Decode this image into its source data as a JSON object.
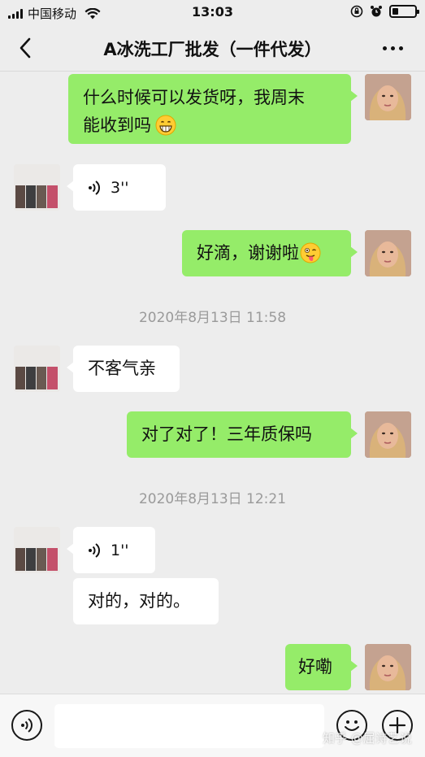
{
  "status_bar": {
    "carrier": "中国移动",
    "time": "13:03"
  },
  "header": {
    "title": "A冰洗工厂批发（一件代发）"
  },
  "messages": [
    {
      "side": "right",
      "type": "text",
      "text": "什么时候可以发货呀，我周末",
      "text2": "能收到吗"
    },
    {
      "side": "left",
      "type": "voice",
      "duration": "3''"
    },
    {
      "side": "right",
      "type": "text",
      "text": "好滴，谢谢啦"
    },
    {
      "type": "timestamp",
      "text": "2020年8月13日 11:58"
    },
    {
      "side": "left",
      "type": "text",
      "text": "不客气亲"
    },
    {
      "side": "right",
      "type": "text",
      "text": "对了对了！三年质保吗"
    },
    {
      "type": "timestamp",
      "text": "2020年8月13日 12:21"
    },
    {
      "side": "left",
      "type": "voice",
      "duration": "1''"
    },
    {
      "side": "left",
      "type": "text",
      "text": "对的，对的。"
    },
    {
      "side": "right",
      "type": "text",
      "text": "好嘞"
    }
  ],
  "icons": {
    "back": "chevron-left-icon",
    "more": "more-dots-icon",
    "voice_input": "voice-input-icon",
    "emoji": "emoji-icon",
    "plus": "plus-icon"
  },
  "colors": {
    "sent_bubble": "#95ec69",
    "received_bubble": "#ffffff",
    "background": "#ededed"
  },
  "watermark": "知乎 @屈诗艺说"
}
